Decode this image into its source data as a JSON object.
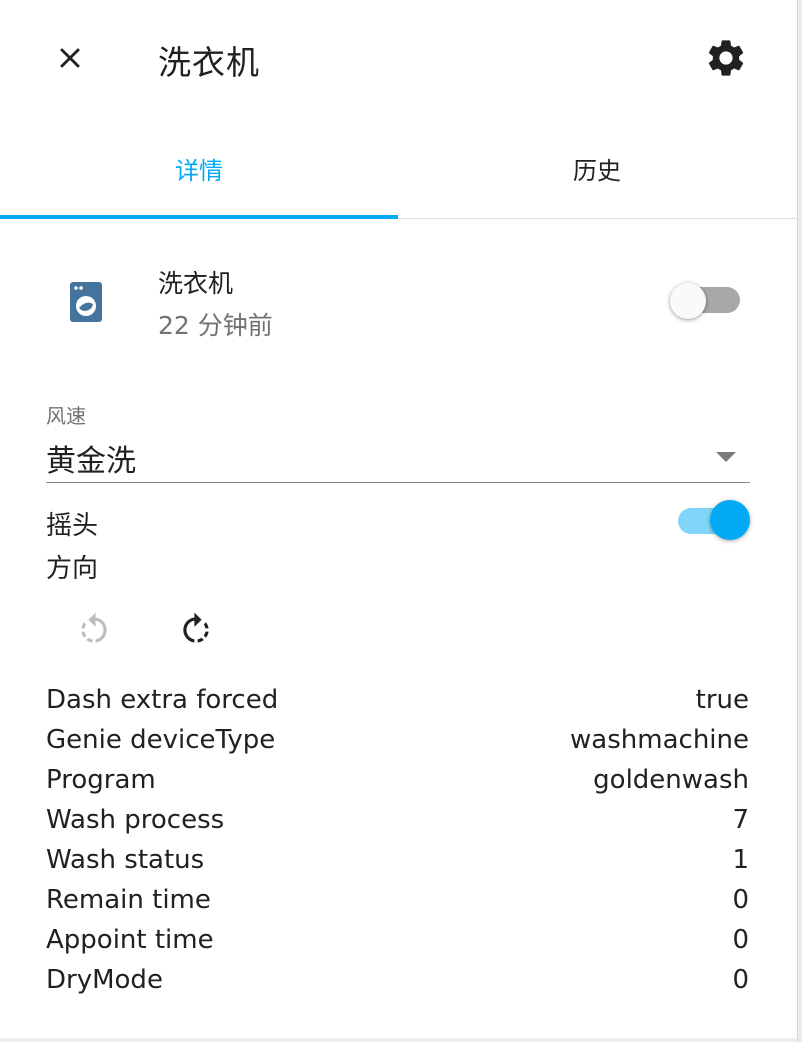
{
  "header": {
    "title": "洗衣机",
    "close_icon": "close-icon",
    "settings_icon": "gear-icon"
  },
  "tabs": [
    {
      "label": "详情",
      "active": true
    },
    {
      "label": "历史",
      "active": false
    }
  ],
  "entity": {
    "name": "洗衣机",
    "last_changed": "22 分钟前",
    "icon": "washing-machine-icon",
    "state_on": false
  },
  "fan_speed": {
    "label": "风速",
    "value": "黄金洗"
  },
  "oscillate": {
    "label": "摇头",
    "on": true
  },
  "direction": {
    "label": "方向",
    "reverse_icon": "rotate-left-icon",
    "forward_icon": "rotate-right-icon"
  },
  "attributes": [
    {
      "name": "Dash extra forced",
      "value": "true"
    },
    {
      "name": "Genie deviceType",
      "value": "washmachine"
    },
    {
      "name": "Program",
      "value": "goldenwash"
    },
    {
      "name": "Wash process",
      "value": "7"
    },
    {
      "name": "Wash status",
      "value": "1"
    },
    {
      "name": "Remain time",
      "value": "0"
    },
    {
      "name": "Appoint time",
      "value": "0"
    },
    {
      "name": "DryMode",
      "value": "0"
    }
  ],
  "colors": {
    "accent": "#03a9f4",
    "accent_light": "#81d4fa",
    "icon": "#44739e",
    "text": "#212121",
    "secondary_text": "#727272"
  }
}
